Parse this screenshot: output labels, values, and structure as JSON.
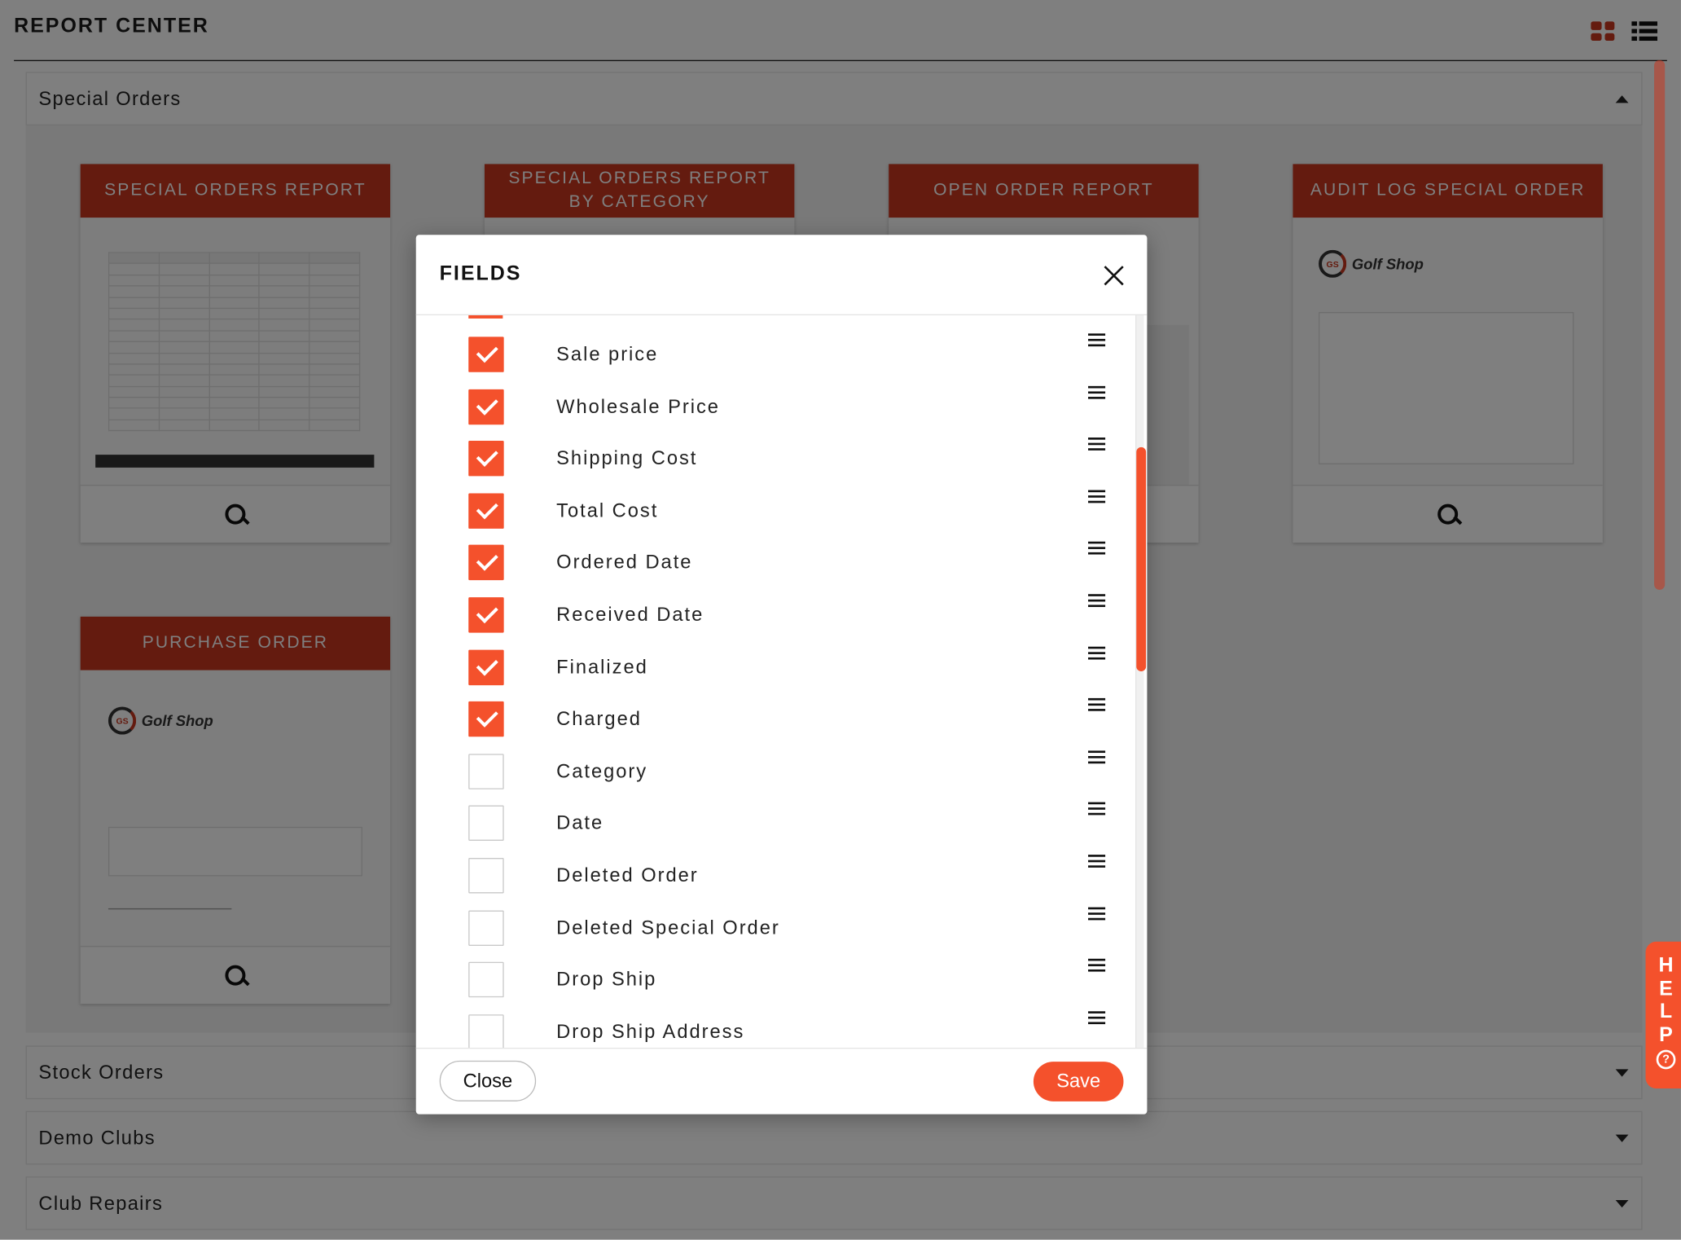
{
  "page": {
    "title": "REPORT CENTER"
  },
  "sections": {
    "special_orders": "Special Orders",
    "stock_orders": "Stock Orders",
    "demo_clubs": "Demo Clubs",
    "club_repairs": "Club Repairs"
  },
  "cards": {
    "special_orders_report": "SPECIAL ORDERS REPORT",
    "special_orders_by_category": "SPECIAL ORDERS REPORT BY CATEGORY",
    "open_order_report": "OPEN ORDER REPORT",
    "audit_log": "AUDIT LOG SPECIAL ORDER",
    "purchase_order": "PURCHASE ORDER",
    "logo_badge": "GS",
    "logo_text": "Golf Shop"
  },
  "modal": {
    "title": "FIELDS",
    "close_label": "Close",
    "save_label": "Save",
    "fields": [
      {
        "label": "Sale price",
        "checked": true
      },
      {
        "label": "Wholesale Price",
        "checked": true
      },
      {
        "label": "Shipping Cost",
        "checked": true
      },
      {
        "label": "Total Cost",
        "checked": true
      },
      {
        "label": "Ordered Date",
        "checked": true
      },
      {
        "label": "Received Date",
        "checked": true
      },
      {
        "label": "Finalized",
        "checked": true
      },
      {
        "label": "Charged",
        "checked": true
      },
      {
        "label": "Category",
        "checked": false
      },
      {
        "label": "Date",
        "checked": false
      },
      {
        "label": "Deleted Order",
        "checked": false
      },
      {
        "label": "Deleted Special Order",
        "checked": false
      },
      {
        "label": "Drop Ship",
        "checked": false
      },
      {
        "label": "Drop Ship Address",
        "checked": false
      }
    ]
  },
  "help": {
    "letters": [
      "H",
      "E",
      "L",
      "P"
    ],
    "icon_glyph": "?"
  },
  "colors": {
    "brand": "#c8361f",
    "accent": "#f4512c"
  },
  "icons": {
    "grid_view": "grid-view-icon",
    "list_view": "list-view-icon",
    "search": "search-icon",
    "close": "close-icon",
    "drag": "drag-handle-icon",
    "help": "question-icon"
  }
}
